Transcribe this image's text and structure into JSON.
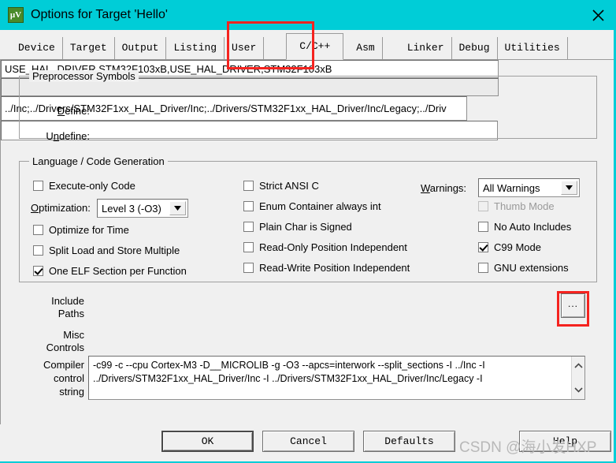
{
  "window": {
    "title": "Options for Target 'Hello'",
    "icon": "uvision-icon",
    "close_label": "✕",
    "titlebar_color": "#00cdd7"
  },
  "tabs": [
    {
      "label": "Device",
      "active": false
    },
    {
      "label": "Target",
      "active": false
    },
    {
      "label": "Output",
      "active": false
    },
    {
      "label": "Listing",
      "active": false
    },
    {
      "label": "User",
      "active": false
    },
    {
      "label": "C/C++",
      "active": true
    },
    {
      "label": "Asm",
      "active": false
    },
    {
      "label": "Linker",
      "active": false
    },
    {
      "label": "Debug",
      "active": false
    },
    {
      "label": "Utilities",
      "active": false
    }
  ],
  "preprocessor": {
    "group_title": "Preprocessor Symbols",
    "define_label": "Define:",
    "define_value": "USE_HAL_DRIVER,STM32F103xB,USE_HAL_DRIVER,STM32F103xB",
    "undefine_label": "Undefine:",
    "undefine_value": ""
  },
  "language": {
    "group_title": "Language / Code Generation",
    "left_column": [
      {
        "label": "Execute-only Code",
        "checked": false,
        "enabled": true
      },
      {
        "label": "Optimize for Time",
        "checked": false,
        "enabled": true
      },
      {
        "label": "Split Load and Store Multiple",
        "checked": false,
        "enabled": true
      },
      {
        "label": "One ELF Section per Function",
        "checked": true,
        "enabled": true
      }
    ],
    "optimization_label": "Optimization:",
    "optimization_value": "Level 3 (-O3)",
    "middle_column": [
      {
        "label": "Strict ANSI C",
        "checked": false,
        "enabled": true
      },
      {
        "label": "Enum Container always int",
        "checked": false,
        "enabled": true
      },
      {
        "label": "Plain Char is Signed",
        "checked": false,
        "enabled": true
      },
      {
        "label": "Read-Only Position Independent",
        "checked": false,
        "enabled": true
      },
      {
        "label": "Read-Write Position Independent",
        "checked": false,
        "enabled": true
      }
    ],
    "warnings_label": "Warnings:",
    "warnings_value": "All Warnings",
    "right_column": [
      {
        "label": "Thumb Mode",
        "checked": false,
        "enabled": false
      },
      {
        "label": "No Auto Includes",
        "checked": false,
        "enabled": true
      },
      {
        "label": "C99 Mode",
        "checked": true,
        "enabled": true
      },
      {
        "label": "GNU extensions",
        "checked": false,
        "enabled": true
      }
    ]
  },
  "paths": {
    "include_label_line1": "Include",
    "include_label_line2": "Paths",
    "include_value": "../Inc;../Drivers/STM32F1xx_HAL_Driver/Inc;../Drivers/STM32F1xx_HAL_Driver/Inc/Legacy;../Driv",
    "browse_label": "...",
    "misc_label_line1": "Misc",
    "misc_label_line2": "Controls",
    "misc_value": ""
  },
  "compiler": {
    "label_line1": "Compiler",
    "label_line2": "control",
    "label_line3": "string",
    "line1": "-c99 -c --cpu Cortex-M3 -D__MICROLIB -g -O3 --apcs=interwork --split_sections -I ../Inc -I",
    "line2": "../Drivers/STM32F1xx_HAL_Driver/Inc -I ../Drivers/STM32F1xx_HAL_Driver/Inc/Legacy -I",
    "scroll_up": "˄",
    "scroll_down": "˅"
  },
  "buttons": {
    "ok": "OK",
    "cancel": "Cancel",
    "defaults": "Defaults",
    "help": "Help"
  },
  "watermark": {
    "text": "CSDN @海小发HXP"
  },
  "annotations": {
    "color": "#f5231f",
    "tab_highlight": "C/C++ tab",
    "browse_highlight": "include paths browse button"
  }
}
